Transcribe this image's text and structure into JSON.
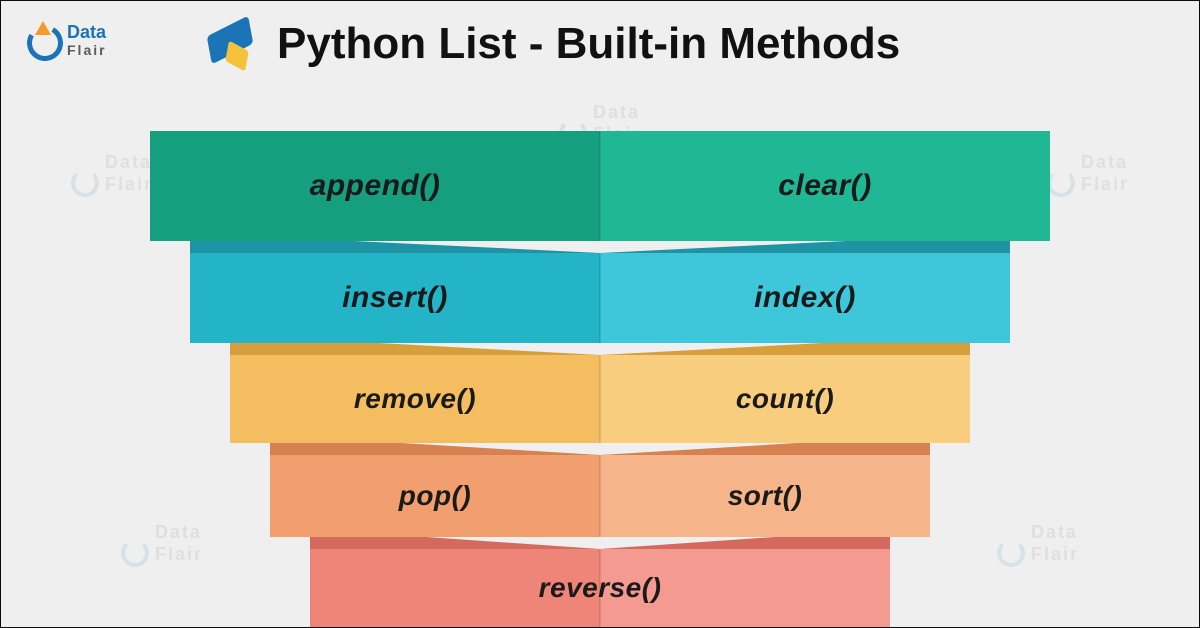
{
  "brand": {
    "line1": "Data",
    "line2": "Flair"
  },
  "title": "Python List - Built-in Methods",
  "rows": [
    {
      "left": "append()",
      "right": "clear()"
    },
    {
      "left": "insert()",
      "right": "index()"
    },
    {
      "left": "remove()",
      "right": "count()"
    },
    {
      "left": "pop()",
      "right": "sort()"
    },
    {
      "center": "reverse()"
    }
  ],
  "colors": {
    "r0": {
      "l": "#169f7f",
      "r": "#20b795"
    },
    "r1": {
      "l": "#24b4c8",
      "r": "#3ec7da"
    },
    "r2": {
      "l": "#f4bd5f",
      "r": "#f8cd7e"
    },
    "r3": {
      "l": "#f19f6f",
      "r": "#f6b48a"
    },
    "r4": {
      "l": "#ef8478",
      "r": "#f49a90"
    }
  },
  "watermark": {
    "line1": "Data",
    "line2": "Flair"
  }
}
